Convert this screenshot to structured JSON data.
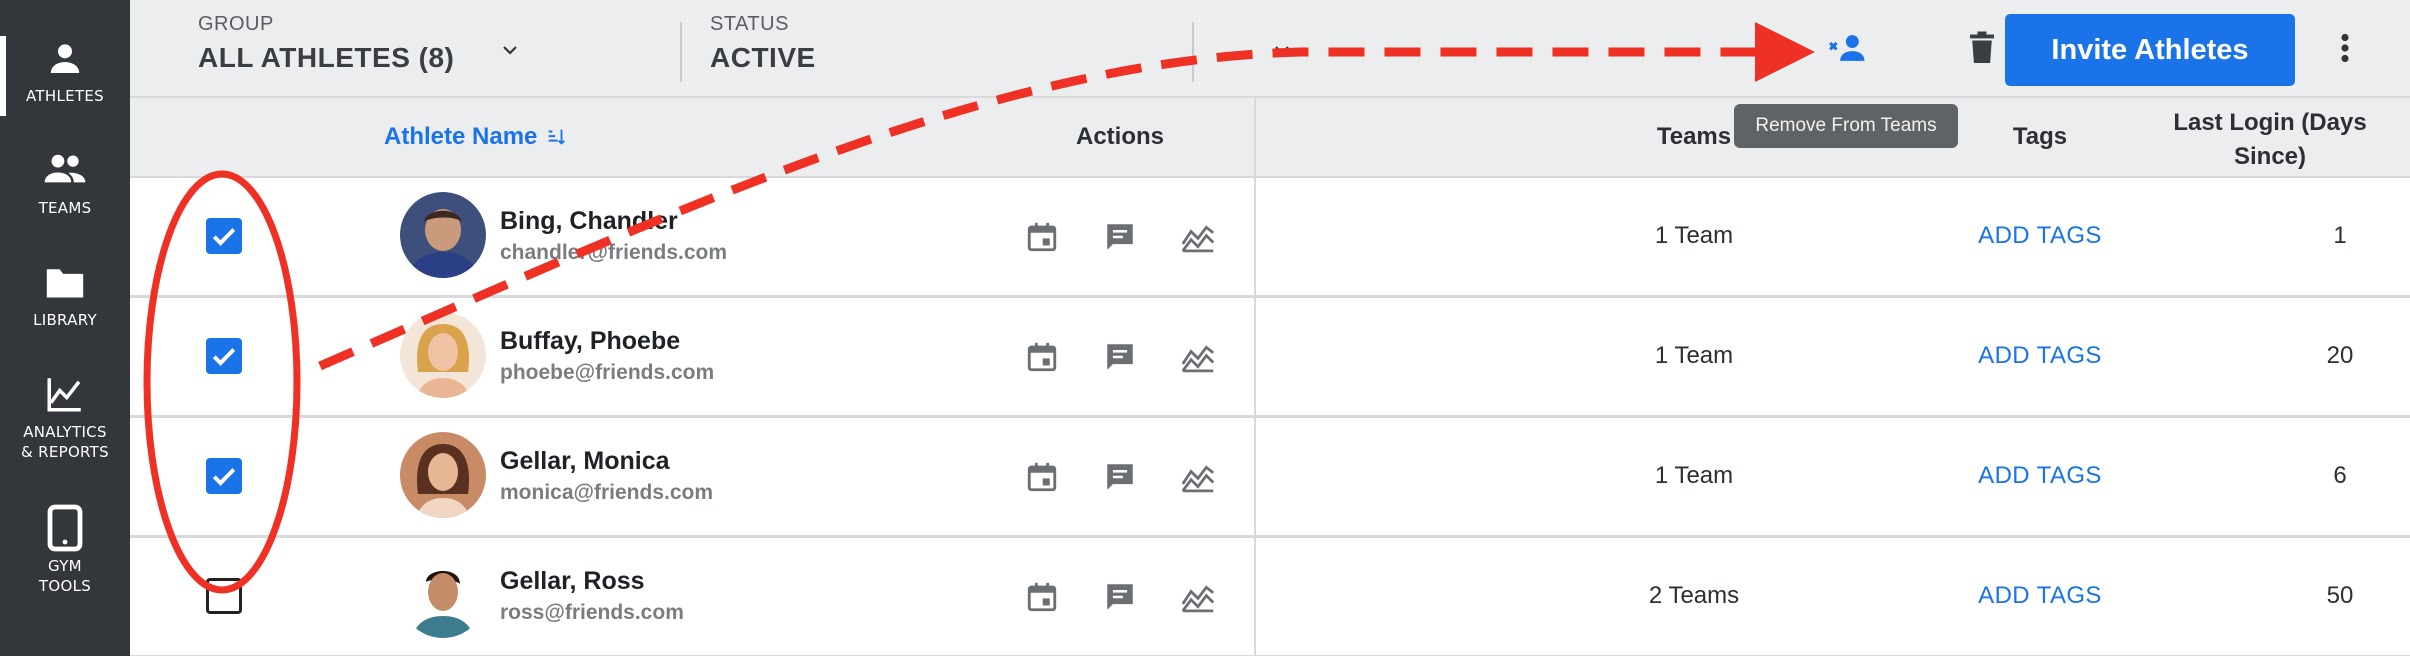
{
  "sidebar": {
    "items": [
      {
        "label": "ATHLETES",
        "icon": "person-icon",
        "active": true
      },
      {
        "label": "TEAMS",
        "icon": "group-icon",
        "active": false
      },
      {
        "label": "LIBRARY",
        "icon": "folder-icon",
        "active": false
      },
      {
        "label": "ANALYTICS\n& REPORTS",
        "icon": "chart-icon",
        "active": false
      },
      {
        "label": "GYM\nTOOLS",
        "icon": "tablet-icon",
        "active": false
      }
    ]
  },
  "header": {
    "group": {
      "caption": "GROUP",
      "value": "ALL ATHLETES (8)"
    },
    "status": {
      "caption": "STATUS",
      "value": "ACTIVE"
    },
    "invite_label": "Invite Athletes",
    "tooltip": "Remove From Teams"
  },
  "table": {
    "columns": {
      "name": "Athlete Name",
      "actions": "Actions",
      "teams": "Teams",
      "tags": "Tags",
      "last_login": "Last Login (Days Since)"
    },
    "rows": [
      {
        "checked": true,
        "name": "Bing, Chandler",
        "email": "chandler@friends.com",
        "teams": "1 Team",
        "tags": "ADD TAGS",
        "last_login": "1"
      },
      {
        "checked": true,
        "name": "Buffay, Phoebe",
        "email": "phoebe@friends.com",
        "teams": "1 Team",
        "tags": "ADD TAGS",
        "last_login": "20"
      },
      {
        "checked": true,
        "name": "Gellar, Monica",
        "email": "monica@friends.com",
        "teams": "1 Team",
        "tags": "ADD TAGS",
        "last_login": "6"
      },
      {
        "checked": false,
        "name": "Gellar, Ross",
        "email": "ross@friends.com",
        "teams": "2 Teams",
        "tags": "ADD TAGS",
        "last_login": "50"
      }
    ]
  },
  "colors": {
    "accent": "#1a73e8",
    "sidebar": "#33363b",
    "annotation": "#ee3124"
  }
}
